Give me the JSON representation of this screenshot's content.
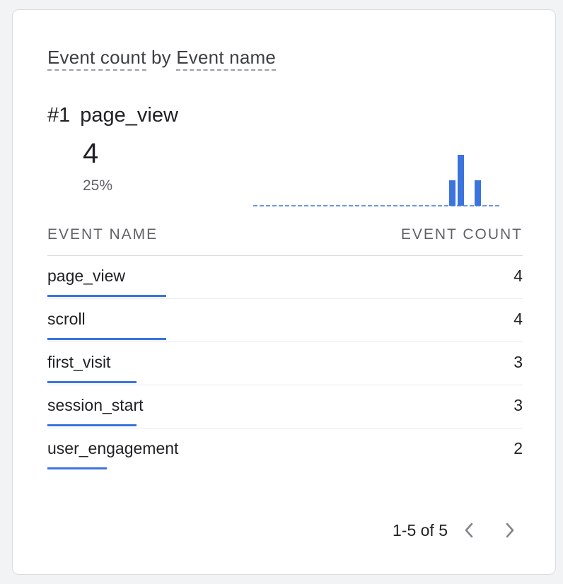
{
  "card": {
    "title_metric": "Event count",
    "title_by": "by",
    "title_dimension": "Event name",
    "top": {
      "rank": "#1",
      "name": "page_view",
      "value": "4",
      "percent": "25%"
    },
    "sparkline": {
      "values": [
        0,
        0,
        0,
        0,
        0,
        0,
        0,
        0,
        0,
        0,
        0,
        0,
        0,
        0,
        0,
        0,
        0,
        0,
        0,
        0,
        0,
        0,
        0,
        3,
        6,
        0,
        3,
        0,
        0
      ],
      "color": "#3b74dc",
      "baseline_style": "dashed"
    },
    "table": {
      "col_name": "EVENT NAME",
      "col_count": "EVENT COUNT",
      "rows": [
        {
          "name": "page_view",
          "count": "4",
          "share": 1.0
        },
        {
          "name": "scroll",
          "count": "4",
          "share": 1.0
        },
        {
          "name": "first_visit",
          "count": "3",
          "share": 0.75
        },
        {
          "name": "session_start",
          "count": "3",
          "share": 0.75
        },
        {
          "name": "user_engagement",
          "count": "2",
          "share": 0.5
        }
      ]
    },
    "pagination": {
      "label": "1-5 of 5",
      "prev_icon": "chevron-left-icon",
      "next_icon": "chevron-right-icon"
    },
    "colors": {
      "accent": "#3b74dc",
      "muted": "#5f6368",
      "pager_icon": "#80868b"
    }
  }
}
